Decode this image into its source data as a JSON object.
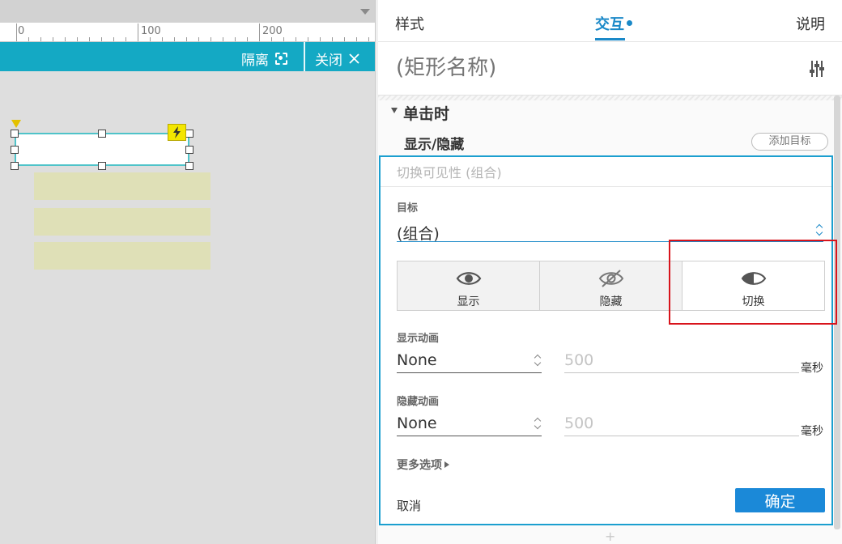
{
  "ruler": {
    "labels": [
      "0",
      "100",
      "200"
    ]
  },
  "isolation_bar": {
    "isolate_label": "隔离",
    "close_label": "关闭"
  },
  "tabs": [
    {
      "label": "样式"
    },
    {
      "label": "交互"
    },
    {
      "label": "说明"
    }
  ],
  "shape_name": {
    "placeholder": "(矩形名称)"
  },
  "event": {
    "title": "单击时"
  },
  "action": {
    "title": "显示/隐藏",
    "add_target_label": "添加目标"
  },
  "config": {
    "summary": "切换可见性 (组合)",
    "target_label": "目标",
    "target_value": "(组合)",
    "visibility_options": [
      {
        "label": "显示",
        "icon": "eye-icon"
      },
      {
        "label": "隐藏",
        "icon": "eye-slash-icon"
      },
      {
        "label": "切换",
        "icon": "eye-toggle-icon",
        "selected": true
      }
    ],
    "show_anim": {
      "label": "显示动画",
      "value": "None",
      "duration_placeholder": "500",
      "unit": "毫秒"
    },
    "hide_anim": {
      "label": "隐藏动画",
      "value": "None",
      "duration_placeholder": "500",
      "unit": "毫秒"
    },
    "more_options": "更多选项",
    "cancel": "取消",
    "ok": "确定"
  },
  "footer": {
    "add_symbol": "+"
  },
  "colors": {
    "accent": "#1b89c8",
    "isolation_bar": "#14a9c4",
    "highlight": "#d8141c"
  }
}
